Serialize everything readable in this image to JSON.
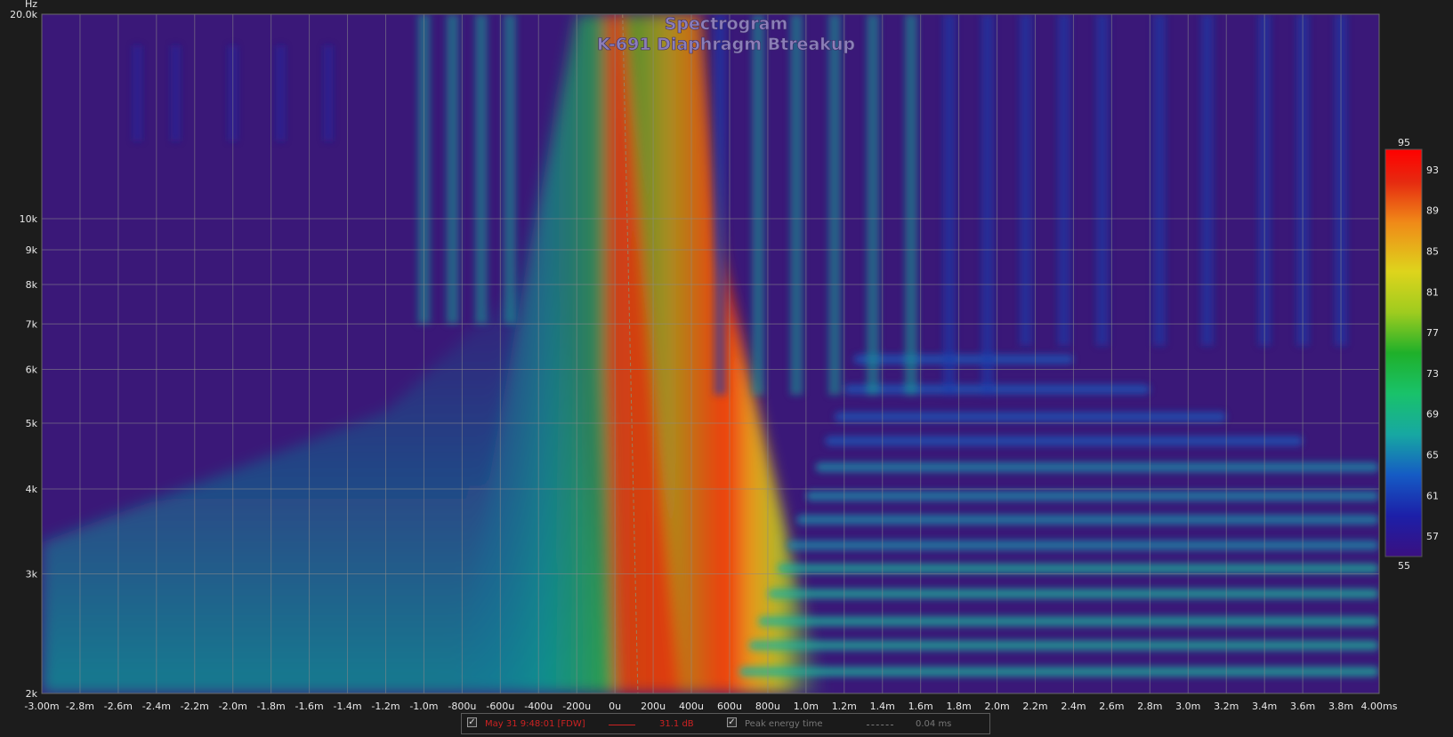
{
  "units": {
    "y_unit": "Hz"
  },
  "chart_data": {
    "type": "heatmap",
    "title": "Spectrogram",
    "subtitle": "K-691  Diaphragm Btreakup",
    "xlabel": "",
    "ylabel": "Hz",
    "x_range_ms": [
      -3.0,
      4.0
    ],
    "y_range_hz": [
      2000,
      20000
    ],
    "y_scale": "log",
    "grid": true,
    "x_ticks": [
      {
        "v": -3.0,
        "label": "-3.00m"
      },
      {
        "v": -2.8,
        "label": "-2.8m"
      },
      {
        "v": -2.6,
        "label": "-2.6m"
      },
      {
        "v": -2.4,
        "label": "-2.4m"
      },
      {
        "v": -2.2,
        "label": "-2.2m"
      },
      {
        "v": -2.0,
        "label": "-2.0m"
      },
      {
        "v": -1.8,
        "label": "-1.8m"
      },
      {
        "v": -1.6,
        "label": "-1.6m"
      },
      {
        "v": -1.4,
        "label": "-1.4m"
      },
      {
        "v": -1.2,
        "label": "-1.2m"
      },
      {
        "v": -1.0,
        "label": "-1.0m"
      },
      {
        "v": -0.8,
        "label": "-800u"
      },
      {
        "v": -0.6,
        "label": "-600u"
      },
      {
        "v": -0.4,
        "label": "-400u"
      },
      {
        "v": -0.2,
        "label": "-200u"
      },
      {
        "v": 0.0,
        "label": "0u"
      },
      {
        "v": 0.2,
        "label": "200u"
      },
      {
        "v": 0.4,
        "label": "400u"
      },
      {
        "v": 0.6,
        "label": "600u"
      },
      {
        "v": 0.8,
        "label": "800u"
      },
      {
        "v": 1.0,
        "label": "1.0m"
      },
      {
        "v": 1.2,
        "label": "1.2m"
      },
      {
        "v": 1.4,
        "label": "1.4m"
      },
      {
        "v": 1.6,
        "label": "1.6m"
      },
      {
        "v": 1.8,
        "label": "1.8m"
      },
      {
        "v": 2.0,
        "label": "2.0m"
      },
      {
        "v": 2.2,
        "label": "2.2m"
      },
      {
        "v": 2.4,
        "label": "2.4m"
      },
      {
        "v": 2.6,
        "label": "2.6m"
      },
      {
        "v": 2.8,
        "label": "2.8m"
      },
      {
        "v": 3.0,
        "label": "3.0m"
      },
      {
        "v": 3.2,
        "label": "3.2m"
      },
      {
        "v": 3.4,
        "label": "3.4m"
      },
      {
        "v": 3.6,
        "label": "3.6m"
      },
      {
        "v": 3.8,
        "label": "3.8m"
      },
      {
        "v": 4.0,
        "label": "4.00ms"
      }
    ],
    "y_ticks": [
      {
        "v": 2000,
        "label": "2k"
      },
      {
        "v": 3000,
        "label": "3k"
      },
      {
        "v": 4000,
        "label": "4k"
      },
      {
        "v": 5000,
        "label": "5k"
      },
      {
        "v": 6000,
        "label": "6k"
      },
      {
        "v": 7000,
        "label": "7k"
      },
      {
        "v": 8000,
        "label": "8k"
      },
      {
        "v": 9000,
        "label": "9k"
      },
      {
        "v": 10000,
        "label": "10k"
      },
      {
        "v": 20000,
        "label": "20.0k"
      }
    ],
    "colorbar": {
      "range_db": [
        55,
        95
      ],
      "ticks": [
        95,
        93,
        89,
        85,
        81,
        77,
        73,
        69,
        65,
        61,
        57,
        55
      ],
      "colors": [
        "#2a0f66",
        "#1c1fa8",
        "#155bc4",
        "#17a8a2",
        "#19c26a",
        "#2fb82a",
        "#9fcc1f",
        "#ded41c",
        "#f08a18",
        "#e62a10",
        "#ff0000"
      ]
    },
    "peak_energy_time_ms": 0.04
  },
  "legend": {
    "series_label": "May 31 9:48:01 [FDW]",
    "series_value": "31.1 dB",
    "series_color": "#cc2222",
    "peak_label": "Peak energy time",
    "peak_value": "0.04 ms",
    "peak_color": "#777777"
  }
}
